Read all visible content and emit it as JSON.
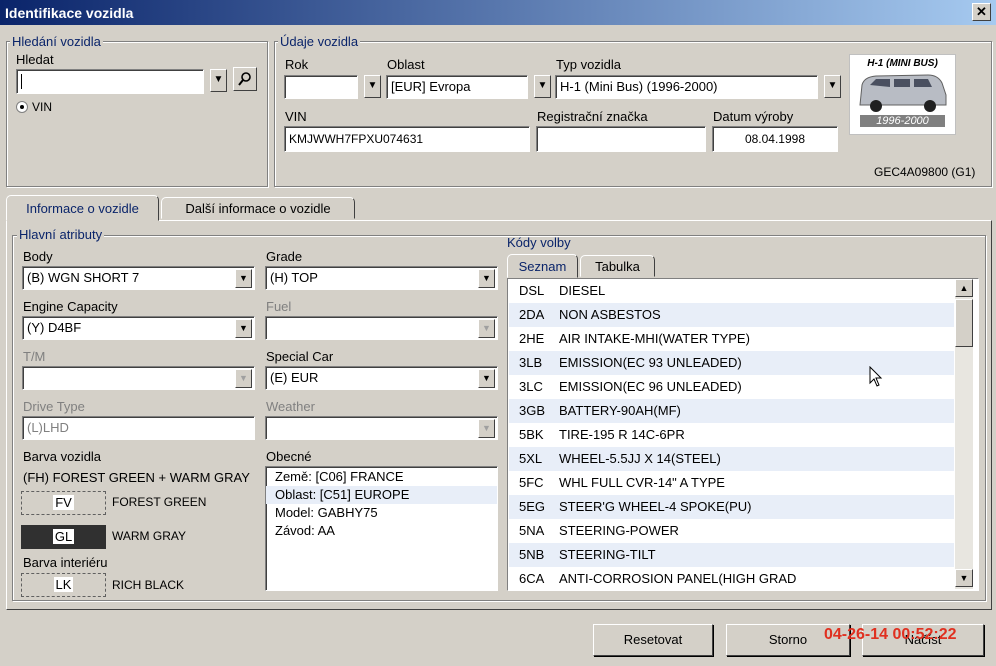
{
  "window": {
    "title": "Identifikace vozidla",
    "close": "✕"
  },
  "search": {
    "group_title": "Hledání vozidla",
    "label": "Hledat",
    "value": "",
    "radio_label": "VIN"
  },
  "vehicle": {
    "group_title": "Údaje vozidla",
    "rok_label": "Rok",
    "rok_value": "",
    "oblast_label": "Oblast",
    "oblast_value": "[EUR]  Evropa",
    "typ_label": "Typ vozidla",
    "typ_value": "H-1 (Mini Bus) (1996-2000)",
    "vin_label": "VIN",
    "vin_value": "KMJWWH7FPXU074631",
    "reg_label": "Registrační značka",
    "reg_value": "",
    "datum_label": "Datum výroby",
    "datum_value": "08.04.1998",
    "code": "GEC4A09800 (G1)",
    "image_title": "H-1 (MINI BUS)",
    "image_years": "1996-2000"
  },
  "tabs": [
    {
      "label": "Informace o vozidle",
      "active": true
    },
    {
      "label": "Další informace o vozidle",
      "active": false
    }
  ],
  "attrs": {
    "group_title": "Hlavní atributy",
    "body_label": "Body",
    "body_value": "(B) WGN SHORT 7",
    "grade_label": "Grade",
    "grade_value": "(H) TOP",
    "engine_label": "Engine Capacity",
    "engine_value": "(Y) D4BF",
    "fuel_label": "Fuel",
    "fuel_value": "",
    "tm_label": "T/M",
    "tm_value": "",
    "special_label": "Special Car",
    "special_value": "(E) EUR",
    "drive_label": "Drive Type",
    "drive_value": "(L)LHD",
    "weather_label": "Weather",
    "weather_value": "",
    "color_label": "Barva vozidla",
    "color_value": "(FH) FOREST GREEN + WARM GRAY",
    "swatch1_code": "FV",
    "swatch1_name": "FOREST GREEN",
    "swatch2_code": "GL",
    "swatch2_name": "WARM GRAY",
    "interior_label": "Barva interiéru",
    "swatch3_code": "LK",
    "swatch3_name": "RICH BLACK",
    "general_label": "Obecné",
    "general_lines": [
      "Země: [C06]  FRANCE",
      "Oblast: [C51]  EUROPE",
      "Model: GABHY75",
      "Závod: AA"
    ]
  },
  "options": {
    "group_title": "Kódy volby",
    "tabs": [
      {
        "label": "Seznam",
        "active": true
      },
      {
        "label": "Tabulka",
        "active": false
      }
    ],
    "rows": [
      {
        "code": "DSL",
        "desc": "DIESEL"
      },
      {
        "code": "2DA",
        "desc": "NON ASBESTOS"
      },
      {
        "code": "2HE",
        "desc": "AIR INTAKE-MHI(WATER TYPE)"
      },
      {
        "code": "3LB",
        "desc": "EMISSION(EC 93 UNLEADED)"
      },
      {
        "code": "3LC",
        "desc": "EMISSION(EC 96 UNLEADED)"
      },
      {
        "code": "3GB",
        "desc": "BATTERY-90AH(MF)"
      },
      {
        "code": "5BK",
        "desc": "TIRE-195 R 14C-6PR"
      },
      {
        "code": "5XL",
        "desc": "WHEEL-5.5JJ X 14(STEEL)"
      },
      {
        "code": "5FC",
        "desc": "WHL FULL CVR-14\" A TYPE"
      },
      {
        "code": "5EG",
        "desc": "STEER'G WHEEL-4 SPOKE(PU)"
      },
      {
        "code": "5NA",
        "desc": "STEERING-POWER"
      },
      {
        "code": "5NB",
        "desc": "STEERING-TILT"
      },
      {
        "code": "6CA",
        "desc": "ANTI-CORROSION PANEL(HIGH GRAD"
      }
    ]
  },
  "buttons": {
    "reset": "Resetovat",
    "cancel": "Storno",
    "load": "Načíst"
  },
  "timestamp": "04-26-14 00:52:22",
  "colors": {
    "title_start": "#0a246a",
    "accent": "#0a246a",
    "timestamp": "#e03020"
  }
}
